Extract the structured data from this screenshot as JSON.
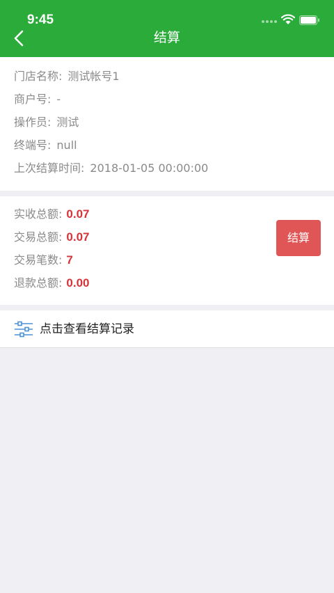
{
  "status": {
    "time": "9:45"
  },
  "nav": {
    "title": "结算"
  },
  "info": {
    "rows": [
      {
        "label": "门店名称:",
        "value": "测试帐号1"
      },
      {
        "label": "商户号:",
        "value": "-"
      },
      {
        "label": "操作员:",
        "value": "测试"
      },
      {
        "label": "终端号:",
        "value": "null"
      },
      {
        "label": "上次结算时间:",
        "value": "2018-01-05 00:00:00"
      }
    ]
  },
  "totals": {
    "rows": [
      {
        "label": "实收总额:",
        "value": "0.07"
      },
      {
        "label": "交易总额:",
        "value": "0.07"
      },
      {
        "label": "交易笔数:",
        "value": "7"
      },
      {
        "label": "退款总额:",
        "value": "0.00"
      }
    ],
    "settle_label": "结算"
  },
  "records": {
    "label": "点击查看结算记录"
  },
  "colors": {
    "header": "#2aab3a",
    "accent_red": "#d6333a",
    "button_red": "#e05555",
    "icon_blue": "#4a90d9"
  },
  "icons": {
    "back": "chevron-left-icon",
    "wifi": "wifi-icon",
    "battery": "battery-icon",
    "records": "sliders-icon"
  }
}
